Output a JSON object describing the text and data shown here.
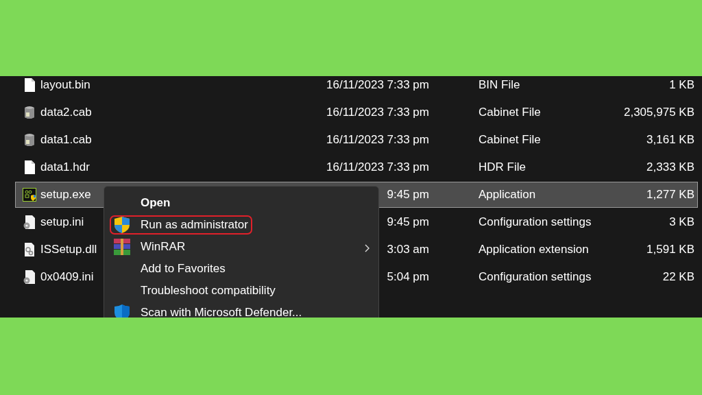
{
  "files": [
    {
      "name": "layout.bin",
      "kind": "blank",
      "modified": "16/11/2023 7:33 pm",
      "type": "BIN File",
      "size": "1 KB",
      "selected": false
    },
    {
      "name": "data2.cab",
      "kind": "cabinet",
      "modified": "16/11/2023 7:33 pm",
      "type": "Cabinet File",
      "size": "2,305,975 KB",
      "selected": false
    },
    {
      "name": "data1.cab",
      "kind": "cabinet",
      "modified": "16/11/2023 7:33 pm",
      "type": "Cabinet File",
      "size": "3,161 KB",
      "selected": false
    },
    {
      "name": "data1.hdr",
      "kind": "blank",
      "modified": "16/11/2023 7:33 pm",
      "type": "HDR File",
      "size": "2,333 KB",
      "selected": false
    },
    {
      "name": "setup.exe",
      "kind": "app",
      "modified": "9:45 pm",
      "type": "Application",
      "size": "1,277 KB",
      "selected": true
    },
    {
      "name": "setup.ini",
      "kind": "settings",
      "modified": "9:45 pm",
      "type": "Configuration settings",
      "size": "3 KB",
      "selected": false
    },
    {
      "name": "ISSetup.dll",
      "kind": "extension",
      "modified": "3:03 am",
      "type": "Application extension",
      "size": "1,591 KB",
      "selected": false
    },
    {
      "name": "0x0409.ini",
      "kind": "settings",
      "modified": "5:04 pm",
      "type": "Configuration settings",
      "size": "22 KB",
      "selected": false
    }
  ],
  "context_menu": {
    "items": [
      {
        "label": "Open",
        "kind": "plain",
        "default": true,
        "submenu": false,
        "highlighted": false
      },
      {
        "label": "Run as administrator",
        "kind": "elevated",
        "default": false,
        "submenu": false,
        "highlighted": true
      },
      {
        "label": "WinRAR",
        "kind": "archiver",
        "default": false,
        "submenu": true,
        "highlighted": false
      },
      {
        "label": "Add to Favorites",
        "kind": "plain",
        "default": false,
        "submenu": false,
        "highlighted": false
      },
      {
        "label": "Troubleshoot compatibility",
        "kind": "plain",
        "default": false,
        "submenu": false,
        "highlighted": false
      },
      {
        "label": "Scan with Microsoft Defender...",
        "kind": "scan",
        "default": false,
        "submenu": false,
        "highlighted": false
      }
    ]
  }
}
